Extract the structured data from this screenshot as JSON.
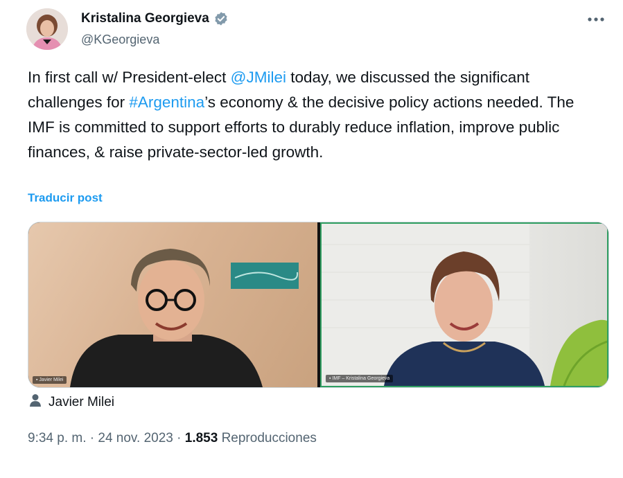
{
  "author": {
    "name": "Kristalina Georgieva",
    "handle": "@KGeorgieva"
  },
  "post": {
    "text_parts": [
      "In first call w/ President-elect ",
      "@JMilei",
      " today, we discussed the significant challenges for ",
      "#Argentina",
      "’s economy & the decisive policy actions needed. The IMF is committed to support efforts to durably reduce inflation, improve public finances, & raise private-sector-led growth."
    ],
    "translate_label": "Traducir post"
  },
  "media": {
    "tag": "Javier Milei"
  },
  "meta": {
    "time": "9:34 p. m.",
    "sep1": " · ",
    "date": "24 nov. 2023",
    "sep2": " · ",
    "views_count": "1.853",
    "views_label": " Reproducciones"
  },
  "colors": {
    "link": "#1d9bf0",
    "secondary_text": "#536471",
    "verified_badge": "#829aab"
  },
  "icons": [
    "verified-badge-icon",
    "more-options-icon",
    "person-tag-icon"
  ]
}
